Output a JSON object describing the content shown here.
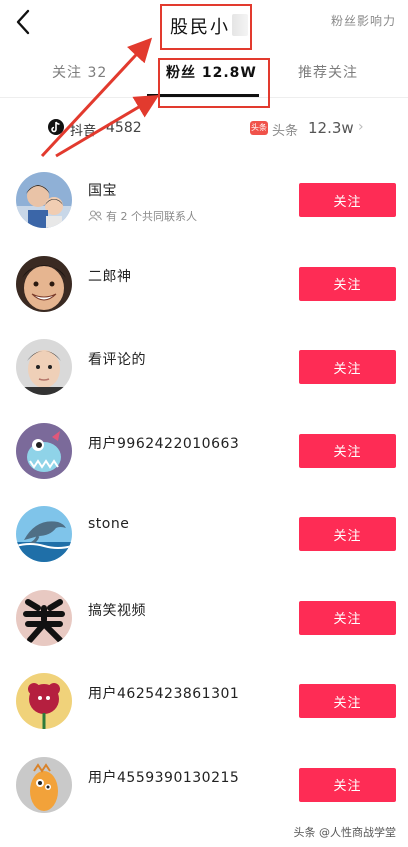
{
  "header": {
    "title": "股民小",
    "right_link": "粉丝影响力"
  },
  "tabs": [
    {
      "label": "关注 32"
    },
    {
      "label": "粉丝 12.8W"
    },
    {
      "label": "推荐关注"
    }
  ],
  "sources": {
    "douyin": {
      "label": "抖音",
      "count": "4582"
    },
    "toutiao": {
      "badge": "头条",
      "label": "头条",
      "count": "12.3w"
    }
  },
  "colors": {
    "accent": "#fe2c55",
    "highlight": "#e23a2e"
  },
  "followers": [
    {
      "name": "国宝",
      "sub": "有 2 个共同联系人",
      "avatar": "family-photo",
      "button": "关注"
    },
    {
      "name": "二郎神",
      "sub": "",
      "avatar": "child-face",
      "button": "关注"
    },
    {
      "name": "看评论的",
      "sub": "",
      "avatar": "boy-selfie",
      "button": "关注"
    },
    {
      "name": "用户9962422010663",
      "sub": "",
      "avatar": "purple-monster",
      "button": "关注"
    },
    {
      "name": "stone",
      "sub": "",
      "avatar": "dolphin",
      "button": "关注"
    },
    {
      "name": "搞笑视频",
      "sub": "",
      "avatar": "xiao-character",
      "button": "关注"
    },
    {
      "name": "用户4625423861301",
      "sub": "",
      "avatar": "red-flower",
      "button": "关注"
    },
    {
      "name": "用户4559390130215",
      "sub": "",
      "avatar": "orange-creature",
      "button": "关注"
    }
  ],
  "watermark": "头条 @人性商战学堂"
}
